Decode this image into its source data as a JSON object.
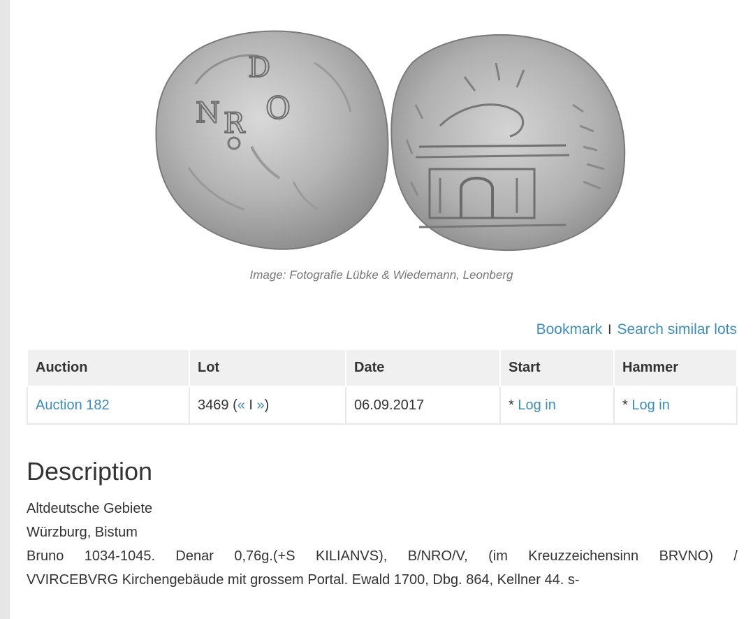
{
  "image": {
    "caption": "Image: Fotografie Lübke & Wiedemann, Leonberg",
    "obverse_icon": "coin-obverse-icon",
    "reverse_icon": "coin-reverse-icon",
    "obverse_letters": "NRO"
  },
  "actions": {
    "bookmark": "Bookmark",
    "separator": "I",
    "search_similar": "Search similar lots"
  },
  "table": {
    "headers": [
      "Auction",
      "Lot",
      "Date",
      "Start",
      "Hammer"
    ],
    "row": {
      "auction": "Auction 182",
      "lot_number": "3469",
      "lot_open": "(",
      "prev": "«",
      "nav_sep": "I",
      "next": "»",
      "lot_close": ")",
      "date": "06.09.2017",
      "start_prefix": "*",
      "start_link": "Log in",
      "hammer_prefix": "*",
      "hammer_link": "Log in"
    }
  },
  "description": {
    "title": "Description",
    "lines": [
      "Altdeutsche Gebiete",
      "Würzburg, Bistum",
      "Bruno 1034-1045. Denar 0,76g.(+S KILIANVS), B/NRO/V, (im Kreuzzeichensinn BRVNO) /",
      "VVIRCEBVRG Kirchengebäude mit grossem Portal. Ewald 1700, Dbg. 864, Kellner 44. s-"
    ]
  },
  "colors": {
    "link": "#3a8dbf",
    "coin_silver": "#b3b3b3",
    "background": "#e6e6e6"
  }
}
